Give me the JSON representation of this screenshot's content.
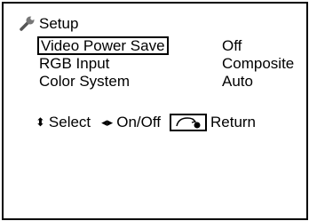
{
  "menu": {
    "title": "Setup",
    "title_icon": "wrench-icon",
    "items": [
      {
        "label": "Video Power Save",
        "value": "Off",
        "selected": true
      },
      {
        "label": "RGB Input",
        "value": "Composite",
        "selected": false
      },
      {
        "label": "Color System",
        "value": "Auto",
        "selected": false
      }
    ]
  },
  "help": {
    "select_glyph": "⬍",
    "select_label": "Select",
    "onoff_glyph": "◂▸",
    "onoff_label": "On/Off",
    "return_icon": "return-button-icon",
    "return_label": "Return"
  }
}
